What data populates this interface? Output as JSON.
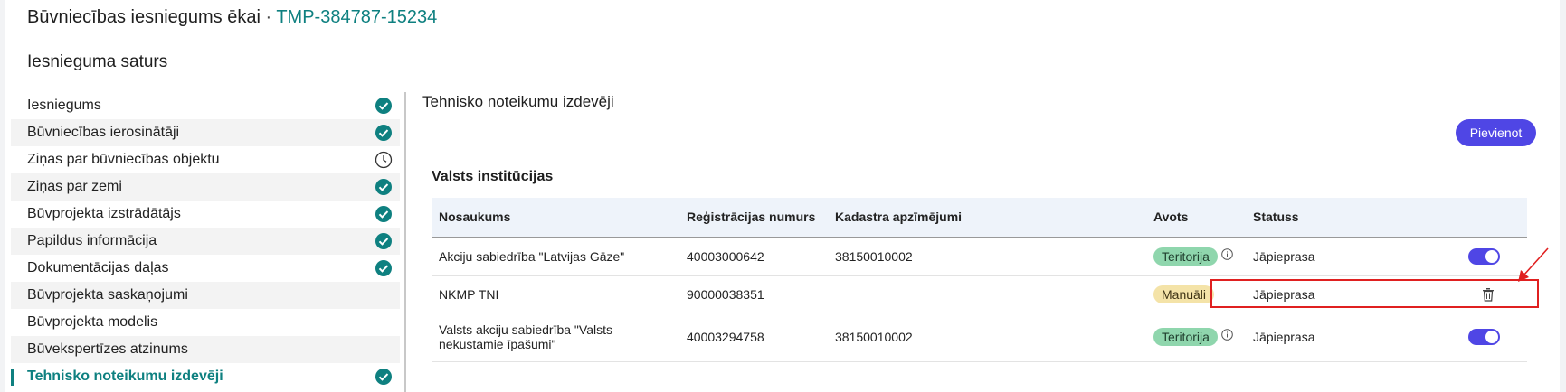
{
  "header": {
    "title": "Būvniecības iesniegums ēkai",
    "separator": " · ",
    "code": "TMP-384787-15234"
  },
  "sidebar": {
    "title": "Iesnieguma saturs",
    "items": [
      {
        "label": "Iesniegums",
        "status": "done"
      },
      {
        "label": "Būvniecības ierosinātāji",
        "status": "done"
      },
      {
        "label": "Ziņas par būvniecības objektu",
        "status": "pending"
      },
      {
        "label": "Ziņas par zemi",
        "status": "done"
      },
      {
        "label": "Būvprojekta izstrādātājs",
        "status": "done"
      },
      {
        "label": "Papildus informācija",
        "status": "done"
      },
      {
        "label": "Dokumentācijas daļas",
        "status": "done"
      },
      {
        "label": "Būvprojekta saskaņojumi",
        "status": "none"
      },
      {
        "label": "Būvprojekta modelis",
        "status": "none"
      },
      {
        "label": "Būvekspertīzes atzinums",
        "status": "none"
      },
      {
        "label": "Tehnisko noteikumu izdevēji",
        "status": "done",
        "active": true
      }
    ]
  },
  "main": {
    "title": "Tehnisko noteikumu izdevēji",
    "add_button": "Pievienot",
    "section_title": "Valsts institūcijas",
    "columns": [
      "Nosaukums",
      "Reģistrācijas numurs",
      "Kadastra apzīmējumi",
      "Avots",
      "Statuss"
    ],
    "rows": [
      {
        "name": "Akciju sabiedrība \"Latvijas Gāze\"",
        "reg": "40003000642",
        "cadastre": "38150010002",
        "source": "Teritorija",
        "status": "Jāpieprasa",
        "action": "toggle"
      },
      {
        "name": "NKMP TNI",
        "reg": "90000038351",
        "cadastre": "",
        "source": "Manuāli",
        "status": "Jāpieprasa",
        "action": "delete"
      },
      {
        "name": "Valsts akciju sabiedrība \"Valsts nekustamie īpašumi\"",
        "reg": "40003294758",
        "cadastre": "38150010002",
        "source": "Teritorija",
        "status": "Jāpieprasa",
        "action": "toggle"
      }
    ]
  },
  "colors": {
    "accent_teal": "#0e8080",
    "primary_button": "#4f46e5",
    "badge_green": "#8fd6ad",
    "badge_yellow": "#f4e3a8",
    "highlight_red": "#e02020"
  }
}
